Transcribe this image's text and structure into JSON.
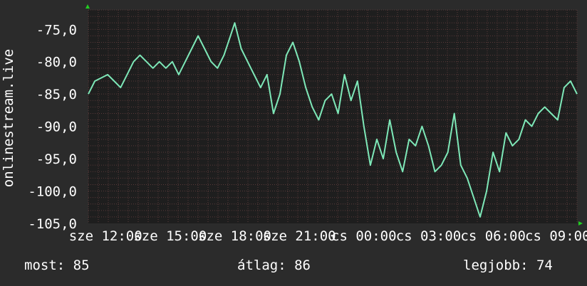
{
  "chart_data": {
    "type": "line",
    "ylabel": "onlinestream.live",
    "ylim": [
      -105,
      -72
    ],
    "y_ticks": [
      "-75,0",
      "-80,0",
      "-85,0",
      "-90,0",
      "-95,0",
      "-100,0",
      "-105,0"
    ],
    "y_tick_values": [
      -75,
      -80,
      -85,
      -90,
      -95,
      -100,
      -105
    ],
    "x_tick_labels": [
      "sze 12:00",
      "sze 15:00",
      "sze 18:00",
      "sze 21:00",
      "cs 00:00",
      "cs 03:00",
      "cs 06:00",
      "cs 09:00"
    ],
    "xlim": [
      11.2,
      33.9
    ],
    "x_tick_values": [
      12,
      15,
      18,
      21,
      24,
      27,
      30,
      33
    ],
    "grid": true,
    "series": [
      {
        "color": "#7ee8b8",
        "x": [
          11.2,
          11.5,
          11.8,
          12.1,
          12.4,
          12.7,
          13.0,
          13.3,
          13.6,
          13.9,
          14.2,
          14.5,
          14.8,
          15.1,
          15.4,
          15.7,
          16.0,
          16.3,
          16.6,
          16.9,
          17.2,
          17.5,
          17.8,
          18.0,
          18.3,
          18.6,
          18.9,
          19.2,
          19.5,
          19.8,
          20.1,
          20.4,
          20.7,
          21.0,
          21.3,
          21.6,
          21.9,
          22.2,
          22.5,
          22.8,
          23.1,
          23.4,
          23.7,
          24.0,
          24.3,
          24.6,
          24.9,
          25.2,
          25.5,
          25.8,
          26.1,
          26.4,
          26.7,
          27.0,
          27.3,
          27.6,
          27.9,
          28.2,
          28.5,
          28.8,
          29.1,
          29.4,
          29.7,
          30.0,
          30.3,
          30.6,
          30.9,
          31.2,
          31.5,
          31.8,
          32.1,
          32.4,
          32.7,
          33.0,
          33.3,
          33.6,
          33.9
        ],
        "values": [
          -85,
          -83,
          -82.5,
          -82,
          -83,
          -84,
          -82,
          -80,
          -79,
          -80,
          -81,
          -80,
          -81,
          -80,
          -82,
          -80,
          -78,
          -76,
          -78,
          -80,
          -81,
          -79,
          -76,
          -74,
          -78,
          -80,
          -82,
          -84,
          -82,
          -88,
          -85,
          -79,
          -77,
          -80,
          -84,
          -87,
          -89,
          -86,
          -85,
          -88,
          -82,
          -86,
          -83,
          -90,
          -96,
          -92,
          -95,
          -89,
          -94,
          -97,
          -92,
          -93,
          -90,
          -93,
          -97,
          -96,
          -94,
          -88,
          -96,
          -98,
          -101,
          -104,
          -100,
          -94,
          -97,
          -91,
          -93,
          -92,
          -89,
          -90,
          -88,
          -87,
          -88,
          -89,
          -84,
          -83,
          -85
        ]
      }
    ]
  },
  "stats": {
    "current": "most: 85",
    "average": "átlag: 86",
    "best": "legjobb: 74"
  },
  "colors": {
    "background": "#2b2b2b",
    "plot_background": "#1e1e1e",
    "grid": "#5a3a3a",
    "line": "#7ee8b8",
    "arrow": "#22cc22",
    "text": "#ffffff"
  }
}
